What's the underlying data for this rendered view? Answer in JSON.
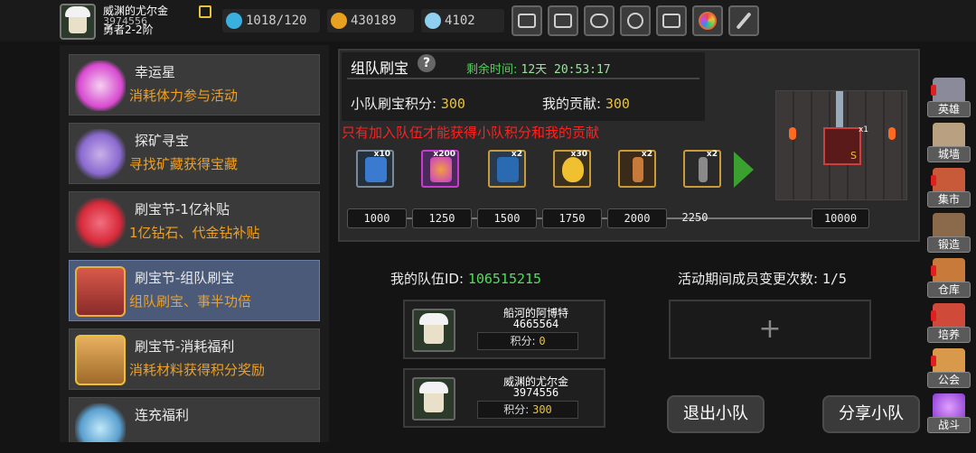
{
  "player": {
    "name": "威渊的尤尔金",
    "id": "3974556",
    "rank": "勇者2-2阶"
  },
  "resources": [
    {
      "name": "stamina",
      "value": "1018/120",
      "icon": "lightning-icon",
      "color": "#3ab0e0"
    },
    {
      "name": "gold",
      "value": "430189",
      "icon": "gold-coin-icon",
      "color": "#e8a020"
    },
    {
      "name": "diamond",
      "value": "4102",
      "icon": "diamond-icon",
      "color": "#8fd0f0"
    }
  ],
  "toolbar": [
    {
      "name": "shop",
      "icon": "cart-icon"
    },
    {
      "name": "mail",
      "icon": "mail-icon"
    },
    {
      "name": "gamepad",
      "icon": "gamepad-icon"
    },
    {
      "name": "settings",
      "icon": "gear-icon"
    },
    {
      "name": "gift",
      "icon": "gift-icon"
    },
    {
      "name": "wheel",
      "icon": "color-wheel-icon"
    },
    {
      "name": "skill",
      "icon": "sword-icon"
    }
  ],
  "events": [
    {
      "title": "幸运星",
      "subtitle": "消耗体力参与活动",
      "color": "#d84ad0"
    },
    {
      "title": "探矿寻宝",
      "subtitle": "寻找矿藏获得宝藏",
      "color": "#8a6ad0"
    },
    {
      "title": "刷宝节-1亿补贴",
      "subtitle": "1亿钻石、代金钻补贴",
      "color": "#d82a3a"
    },
    {
      "title": "刷宝节-组队刷宝",
      "subtitle": "组队刷宝、事半功倍",
      "color": "#b83a3a"
    },
    {
      "title": "刷宝节-消耗福利",
      "subtitle": "消耗材料获得积分奖励",
      "color": "#c88a3a"
    },
    {
      "title": "连充福利",
      "subtitle": "",
      "color": "#5aa0d0"
    }
  ],
  "team_event": {
    "title": "组队刷宝",
    "help": "?",
    "remaining_label": "剩余时间:",
    "remaining_value": "12天 20:53:17",
    "score_label": "小队刷宝积分:",
    "score_value": "300",
    "contrib_label": "我的贡献:",
    "contrib_value": "300",
    "warning": "只有加入队伍才能获得小队积分和我的贡献",
    "rewards": [
      {
        "count": "x10",
        "color": "#3a7ad0",
        "icon": "lightning-scroll-icon"
      },
      {
        "count": "x200",
        "color": "#c83ad0",
        "icon": "fire-orb-icon"
      },
      {
        "count": "x2",
        "color": "#2a6ab0",
        "icon": "spellbook-icon"
      },
      {
        "count": "x30",
        "color": "#f0c030",
        "icon": "golden-egg-icon"
      },
      {
        "count": "x2",
        "color": "#c87a3a",
        "icon": "scroll-icon"
      },
      {
        "count": "x2",
        "color": "#8a8a8a",
        "icon": "hammer-icon"
      }
    ],
    "milestones": [
      "1000",
      "1250",
      "1500",
      "1750",
      "2000",
      "2250",
      "10000"
    ],
    "grand_prize_count": "x1",
    "grand_prize_tag": "S"
  },
  "team": {
    "id_label": "我的队伍ID:",
    "id_value": "106515215",
    "changes_label": "活动期间成员变更次数:",
    "changes_value": "1/5",
    "members": [
      {
        "name": "船河的阿博特",
        "id": "4665564",
        "score_label": "积分:",
        "score_value": "0"
      },
      {
        "name": "威渊的尤尔金",
        "id": "3974556",
        "score_label": "积分:",
        "score_value": "300"
      }
    ],
    "add_symbol": "+",
    "leave_label": "退出小队",
    "share_label": "分享小队"
  },
  "right_nav": [
    {
      "label": "英雄",
      "icon": "helmet-icon",
      "color": "#8a8a9a",
      "alert": true
    },
    {
      "label": "城墙",
      "icon": "wall-icon",
      "color": "#b8a080",
      "alert": false
    },
    {
      "label": "集市",
      "icon": "market-icon",
      "color": "#c85a3a",
      "alert": true
    },
    {
      "label": "锻造",
      "icon": "anvil-icon",
      "color": "#8a6a4a",
      "alert": false
    },
    {
      "label": "仓库",
      "icon": "warehouse-icon",
      "color": "#c87a3a",
      "alert": true
    },
    {
      "label": "培养",
      "icon": "training-icon",
      "color": "#d04a3a",
      "alert": true
    },
    {
      "label": "公会",
      "icon": "guild-icon",
      "color": "#d89a4a",
      "alert": true
    },
    {
      "label": "战斗",
      "icon": "portal-icon",
      "color": "#8a3ad0",
      "alert": false
    }
  ]
}
